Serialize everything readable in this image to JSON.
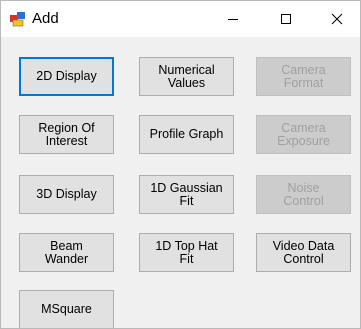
{
  "window": {
    "title": "Add",
    "icon": "windows-forms-app-icon",
    "controls": {
      "minimize_icon": "minimize-icon",
      "maximize_icon": "maximize-icon",
      "close_icon": "close-icon"
    }
  },
  "colors": {
    "titlebar_bg": "#ffffff",
    "client_bg": "#f0f0f0",
    "button_bg": "#e1e1e1",
    "button_border": "#adadad",
    "focus_border": "#0078d7",
    "disabled_text": "#a0a0a0"
  },
  "buttons": [
    {
      "label": "2D Display",
      "enabled": true,
      "focused": true
    },
    {
      "label": "Numerical\nValues",
      "enabled": true
    },
    {
      "label": "Camera\nFormat",
      "enabled": false
    },
    {
      "label": "Region Of\nInterest",
      "enabled": true
    },
    {
      "label": "Profile Graph",
      "enabled": true
    },
    {
      "label": "Camera\nExposure",
      "enabled": false
    },
    {
      "label": "3D Display",
      "enabled": true
    },
    {
      "label": "1D Gaussian\nFit",
      "enabled": true
    },
    {
      "label": "Noise\nControl",
      "enabled": false
    },
    {
      "label": "Beam\nWander",
      "enabled": true
    },
    {
      "label": "1D Top Hat\nFit",
      "enabled": true
    },
    {
      "label": "Video Data\nControl",
      "enabled": true
    },
    {
      "label": "MSquare",
      "enabled": true
    }
  ]
}
